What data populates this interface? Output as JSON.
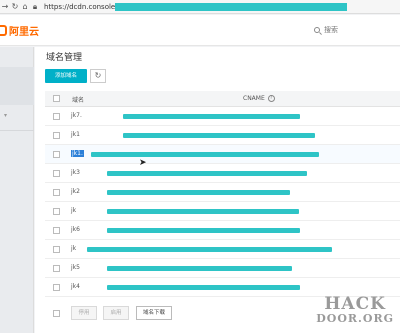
{
  "browser": {
    "url": "https://dcdn.console.aliyun",
    "url_redaction_color": "#2ec4c6"
  },
  "topbar": {
    "logo_text": "阿里云",
    "brand_color": "#ff6a00",
    "search_label": "搜索"
  },
  "main": {
    "title": "域名管理",
    "add_button_label": "添加域名",
    "refresh_icon": "↻",
    "table": {
      "col_domain": "域名",
      "col_cname": "CNAME",
      "cname_help_icon": "?",
      "rows": [
        {
          "domain": "jk7.",
          "selected": false
        },
        {
          "domain": "jk1",
          "selected": false
        },
        {
          "domain": "jk1.",
          "selected": true
        },
        {
          "domain": "jk3",
          "selected": false
        },
        {
          "domain": "jk2",
          "selected": false
        },
        {
          "domain": "jk",
          "selected": false
        },
        {
          "domain": "jk6",
          "selected": false
        },
        {
          "domain": "jk",
          "selected": false
        },
        {
          "domain": "jk5",
          "selected": false
        },
        {
          "domain": "jk4",
          "selected": false
        }
      ]
    },
    "footer": {
      "disable_label": "停用",
      "enable_label": "启用",
      "offline_label": "域名下载"
    }
  },
  "watermark": {
    "line1": "HACK",
    "line2": "DOOR.ORG"
  }
}
